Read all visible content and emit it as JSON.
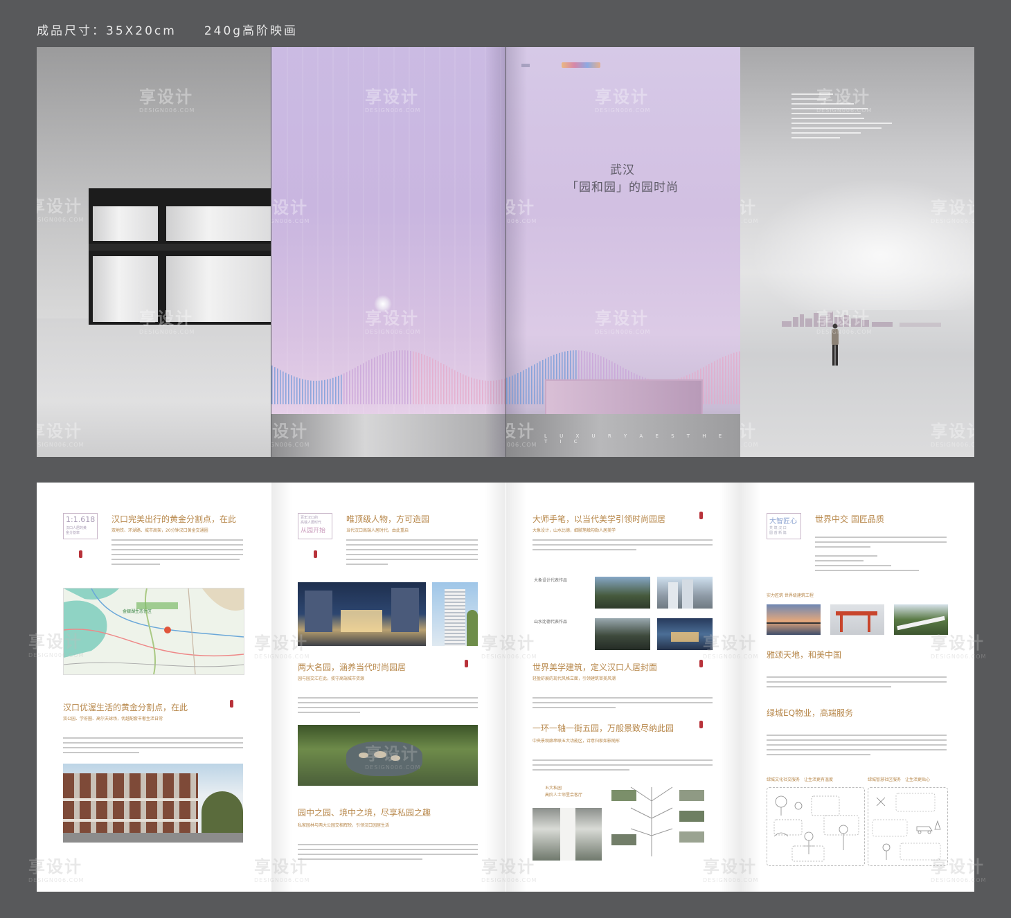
{
  "spec": "成品尺寸：35X20cm　　240g高阶映画",
  "watermark": {
    "cn": "享设计",
    "en": "DESIGN006.COM"
  },
  "cover": {
    "title_line1": "武汉",
    "title_line2": "「园和园」的园时尚",
    "tagline": "L U X U R Y   A E S T H E T I C",
    "back_tagline": "L U X U R Y   A E S T H E T I C"
  },
  "pages": {
    "p1": {
      "logo_ratio": "1:1.618",
      "logo_sub": "汉口人居的黄金分割率",
      "h1": "汉口完美出行的黄金分割点，在此",
      "s1": "双地铁、环湖路、城市高架，20分钟汉口黄金交通圈",
      "h2": "汉口优渥生活的黄金分割点，在此",
      "s2": "双公园、学府圈、高尔夫球场，优越配套丰奢生活日常",
      "map_label": "金银湖生态住区"
    },
    "p2": {
      "logo_line1": "百年汉口的",
      "logo_line2": "高端人居时代",
      "logo_line3": "从园开始",
      "h1": "唯顶级人物，方可造园",
      "s1": "当代汉口高端人居时代，由此重启",
      "h2": "两大名园，涵养当代时尚园居",
      "s2": "园与园交汇在此，揽守高端城市资源",
      "h3": "园中之园、境中之境，尽享私园之趣",
      "s3": "私家园林与两大公园交相辉映，引领汉口园居生活"
    },
    "p3": {
      "h1": "大师手笔，以当代美学引领时尚园居",
      "s1": "大象设计，山水比德，细腻笔触勾勒人居美学",
      "work1": "大象设计代表作品",
      "work2": "山水比德代表作品",
      "h2": "世界美学建筑，定义汉口人居封面",
      "s2": "轻盈舒展的现代风格立面，引领建筑审美风潮",
      "h3": "一环一轴一街五园，万般景致尽纳此园",
      "s3": "中央景观廊串联五大功能区，诗意归家如影随形",
      "garden_label1": "五大私园",
      "garden_label2": "高阶人士邻里会客厅"
    },
    "p4": {
      "logo_line1": "大智匠心",
      "logo_line2": "共 筑 汉 口",
      "logo_line3": "圆 首 新 篇",
      "h1": "世界中交 国匠品质",
      "eng": "实力匠筑 世界级建筑工程",
      "h2": "雅颂天地，和美中国",
      "h3": "绿城EQ物业，高端服务",
      "svc1": "绿城文化社交服务　让生活更有温度",
      "svc2": "绿城智慧社区服务　让生活更贴心"
    }
  },
  "colors": {
    "gold": "#b7874a",
    "seal": "#b8323a",
    "bg": "#58595b"
  }
}
